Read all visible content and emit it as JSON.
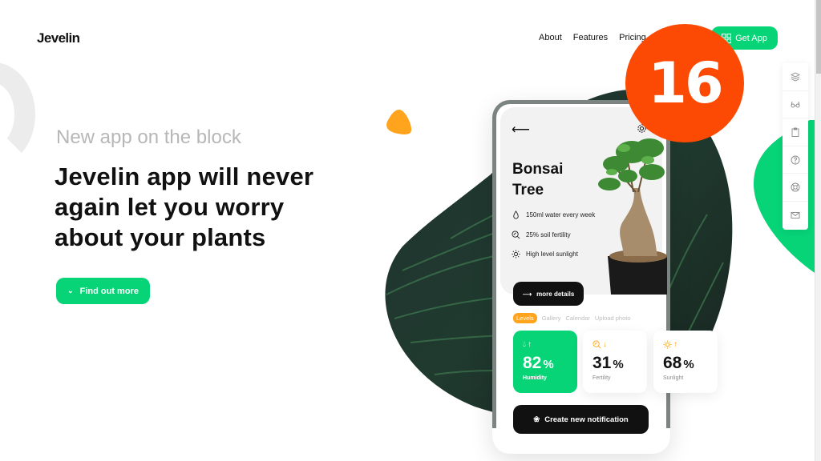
{
  "header": {
    "logo": "Jevelin",
    "nav": [
      "About",
      "Features",
      "Pricing"
    ],
    "cta_label": "Get App"
  },
  "hero": {
    "kicker": "New app on the block",
    "headline": "Jevelin app will never again let you worry about your plants",
    "button_label": "Find out more"
  },
  "badge": {
    "number": "16"
  },
  "phone": {
    "plant_title_line1": "Bonsai",
    "plant_title_line2": "Tree",
    "attributes": [
      {
        "icon": "water-drop-icon",
        "text": "150ml water every week"
      },
      {
        "icon": "soil-icon",
        "text": "25% soil fertility"
      },
      {
        "icon": "sun-icon",
        "text": "High level sunlight"
      }
    ],
    "more_button": "more details",
    "tabs": [
      {
        "label": "Levels",
        "active": true
      },
      {
        "label": "Gallery",
        "active": false
      },
      {
        "label": "Calendar",
        "active": false
      },
      {
        "label": "Upload photo",
        "active": false
      }
    ],
    "stats": [
      {
        "value": "82",
        "unit": "%",
        "label": "Humidity",
        "trend": "↑"
      },
      {
        "value": "31",
        "unit": "%",
        "label": "Fertility",
        "trend": "↓"
      },
      {
        "value": "68",
        "unit": "%",
        "label": "Sunlight",
        "trend": "↑"
      }
    ],
    "notification_button": "Create new notification"
  },
  "side_panel": {
    "items": [
      "layers-icon",
      "glasses-icon",
      "clipboard-icon",
      "help-icon",
      "lifebuoy-icon",
      "mail-icon"
    ]
  },
  "colors": {
    "accent_green": "#07d377",
    "accent_orange": "#ffa41c",
    "badge_red": "#fc4a05",
    "dark": "#111111"
  }
}
